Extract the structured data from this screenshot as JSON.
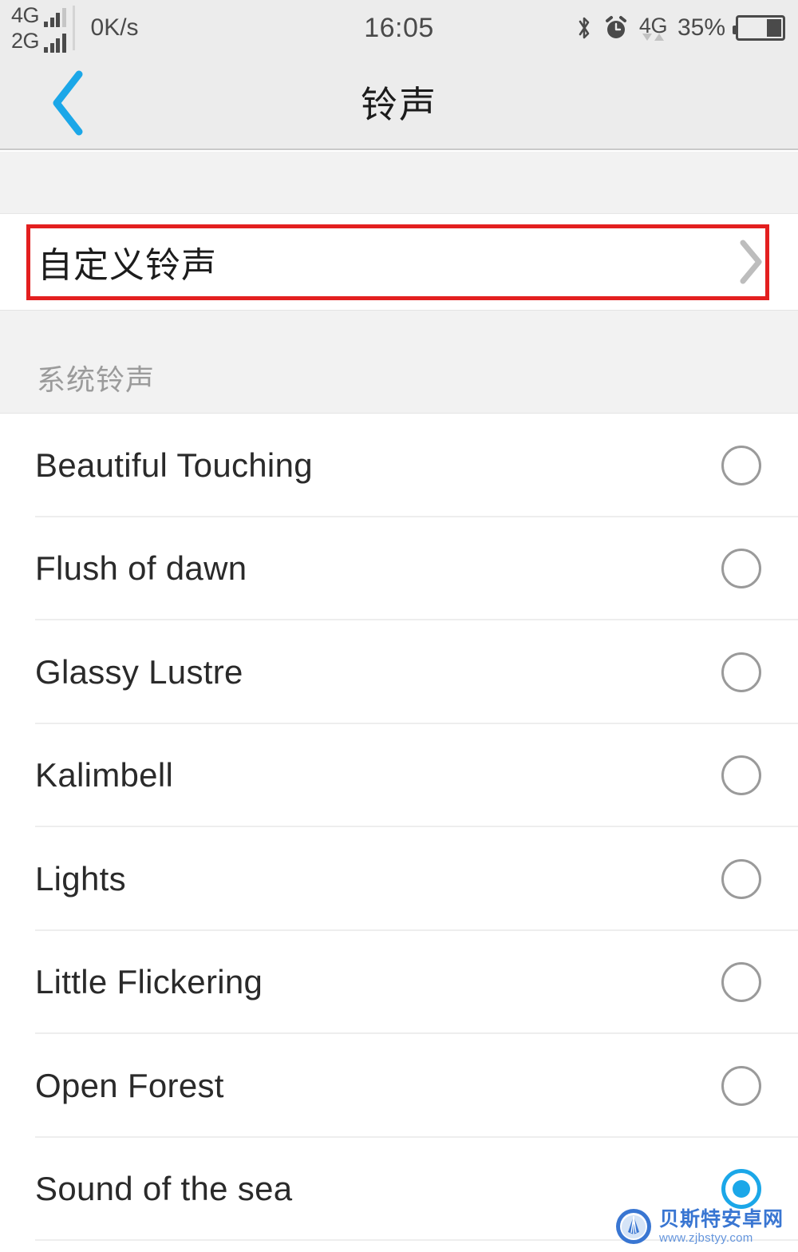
{
  "status_bar": {
    "sim1_label": "4G",
    "sim2_label": "2G",
    "network_speed": "0K/s",
    "clock": "16:05",
    "bluetooth_icon": "bluetooth-icon",
    "alarm_icon": "alarm-clock-icon",
    "data_label": "4G",
    "battery_percent": "35%",
    "battery_level": 35
  },
  "header": {
    "back_icon": "back-chevron-icon",
    "title": "铃声",
    "back_color": "#1ba7e8"
  },
  "custom_ringtone": {
    "label": "自定义铃声",
    "chevron_icon": "chevron-right-icon",
    "highlight_color": "#e31f1f"
  },
  "system_section": {
    "header": "系统铃声",
    "items": [
      {
        "name": "Beautiful Touching",
        "selected": false
      },
      {
        "name": "Flush of dawn",
        "selected": false
      },
      {
        "name": "Glassy Lustre",
        "selected": false
      },
      {
        "name": "Kalimbell",
        "selected": false
      },
      {
        "name": "Lights",
        "selected": false
      },
      {
        "name": "Little Flickering",
        "selected": false
      },
      {
        "name": "Open Forest",
        "selected": false
      },
      {
        "name": "Sound of the sea",
        "selected": true
      }
    ],
    "selected_color": "#1ba7e8"
  },
  "watermark": {
    "site_name": "贝斯特安卓网",
    "url": "www.zjbstyy.com",
    "logo_icon": "shell-logo-icon"
  }
}
